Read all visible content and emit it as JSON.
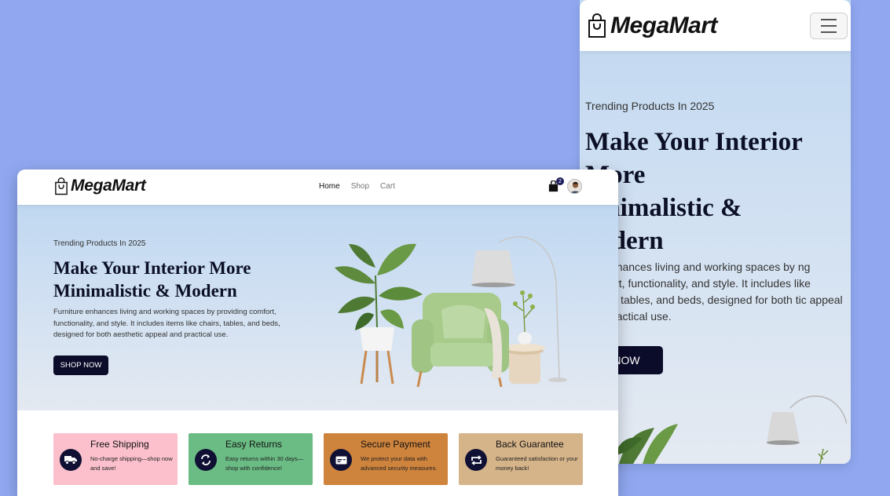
{
  "brand": {
    "name": "MegaMart"
  },
  "nav": {
    "links": [
      "Home",
      "Shop",
      "Cart"
    ],
    "active": "Home",
    "cart_count": "2"
  },
  "hero": {
    "eyebrow": "Trending Products In 2025",
    "title": "Make Your Interior More Minimalistic & Modern",
    "mobile_title": "Make Your Interior More\nMinimalistic & Modern",
    "description": "Furniture enhances living and working spaces by providing comfort, functionality, and style. It includes items like chairs, tables, and beds, designed for both aesthetic appeal and practical use.",
    "mobile_description": "ure enhances living and working spaces by ng comfort, functionality, and style. It includes like chairs, tables, and beds, designed for both tic appeal and practical use.",
    "cta": "SHOP NOW",
    "mobile_cta": "P NOW"
  },
  "features": [
    {
      "title": "Free Shipping",
      "text": "No-charge shipping—shop now and save!",
      "color": "#fbc0cc",
      "icon": "truck-icon"
    },
    {
      "title": "Easy Returns",
      "text": "Easy returns within 30 days—shop with confidence!",
      "color": "#6bbc84",
      "icon": "refresh-icon"
    },
    {
      "title": "Secure Payment",
      "text": "We protect your data with advanced security measures.",
      "color": "#cf843d",
      "icon": "card-icon"
    },
    {
      "title": "Back Guarantee",
      "text": "Guaranteed satisfaction or your money back!",
      "color": "#d6b48a",
      "icon": "repeat-icon"
    }
  ],
  "colors": {
    "page_background": "#91a8f1",
    "button": "#0b0b2a",
    "heading": "#0c1026"
  }
}
